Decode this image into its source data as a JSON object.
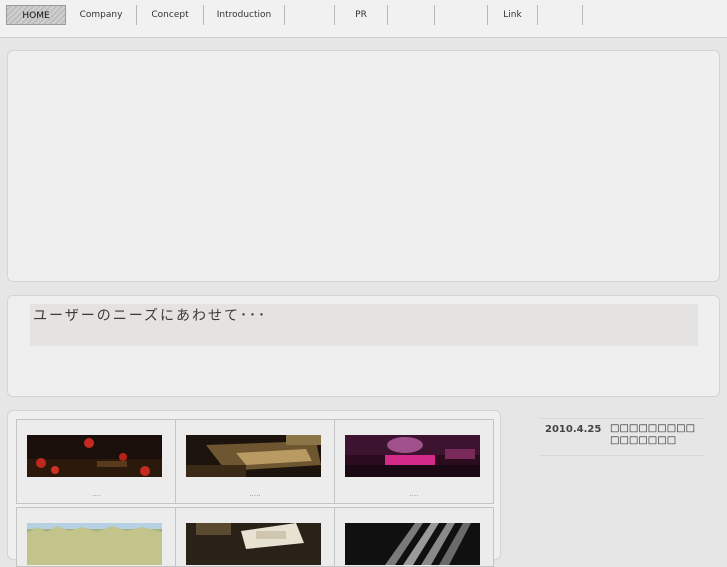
{
  "nav": {
    "items": [
      {
        "label": "HOME",
        "active": true
      },
      {
        "label": "Company"
      },
      {
        "label": "Concept"
      },
      {
        "label": "Introduction"
      },
      {
        "label": ""
      },
      {
        "label": "PR"
      },
      {
        "label": ""
      },
      {
        "label": ""
      },
      {
        "label": "Link"
      },
      {
        "label": ""
      }
    ]
  },
  "intro": {
    "heading": "ユーザーのニーズにあわせて･･･"
  },
  "gallery": {
    "items": [
      {
        "caption": "....",
        "scene": "red-flowers"
      },
      {
        "caption": ".....",
        "scene": "dark-room"
      },
      {
        "caption": "....",
        "scene": "pink-lounge"
      },
      {
        "caption": "",
        "scene": "grass-sky"
      },
      {
        "caption": "",
        "scene": "phone"
      },
      {
        "caption": "",
        "scene": "metal-bars"
      }
    ]
  },
  "news": {
    "items": [
      {
        "date": "2010.4.25",
        "title": "□□□□□□□□□□□□□□□□"
      }
    ]
  },
  "colors": {
    "background": "#e6e6e6",
    "panel": "#efefef",
    "nav_active": "#c8c8c8"
  }
}
